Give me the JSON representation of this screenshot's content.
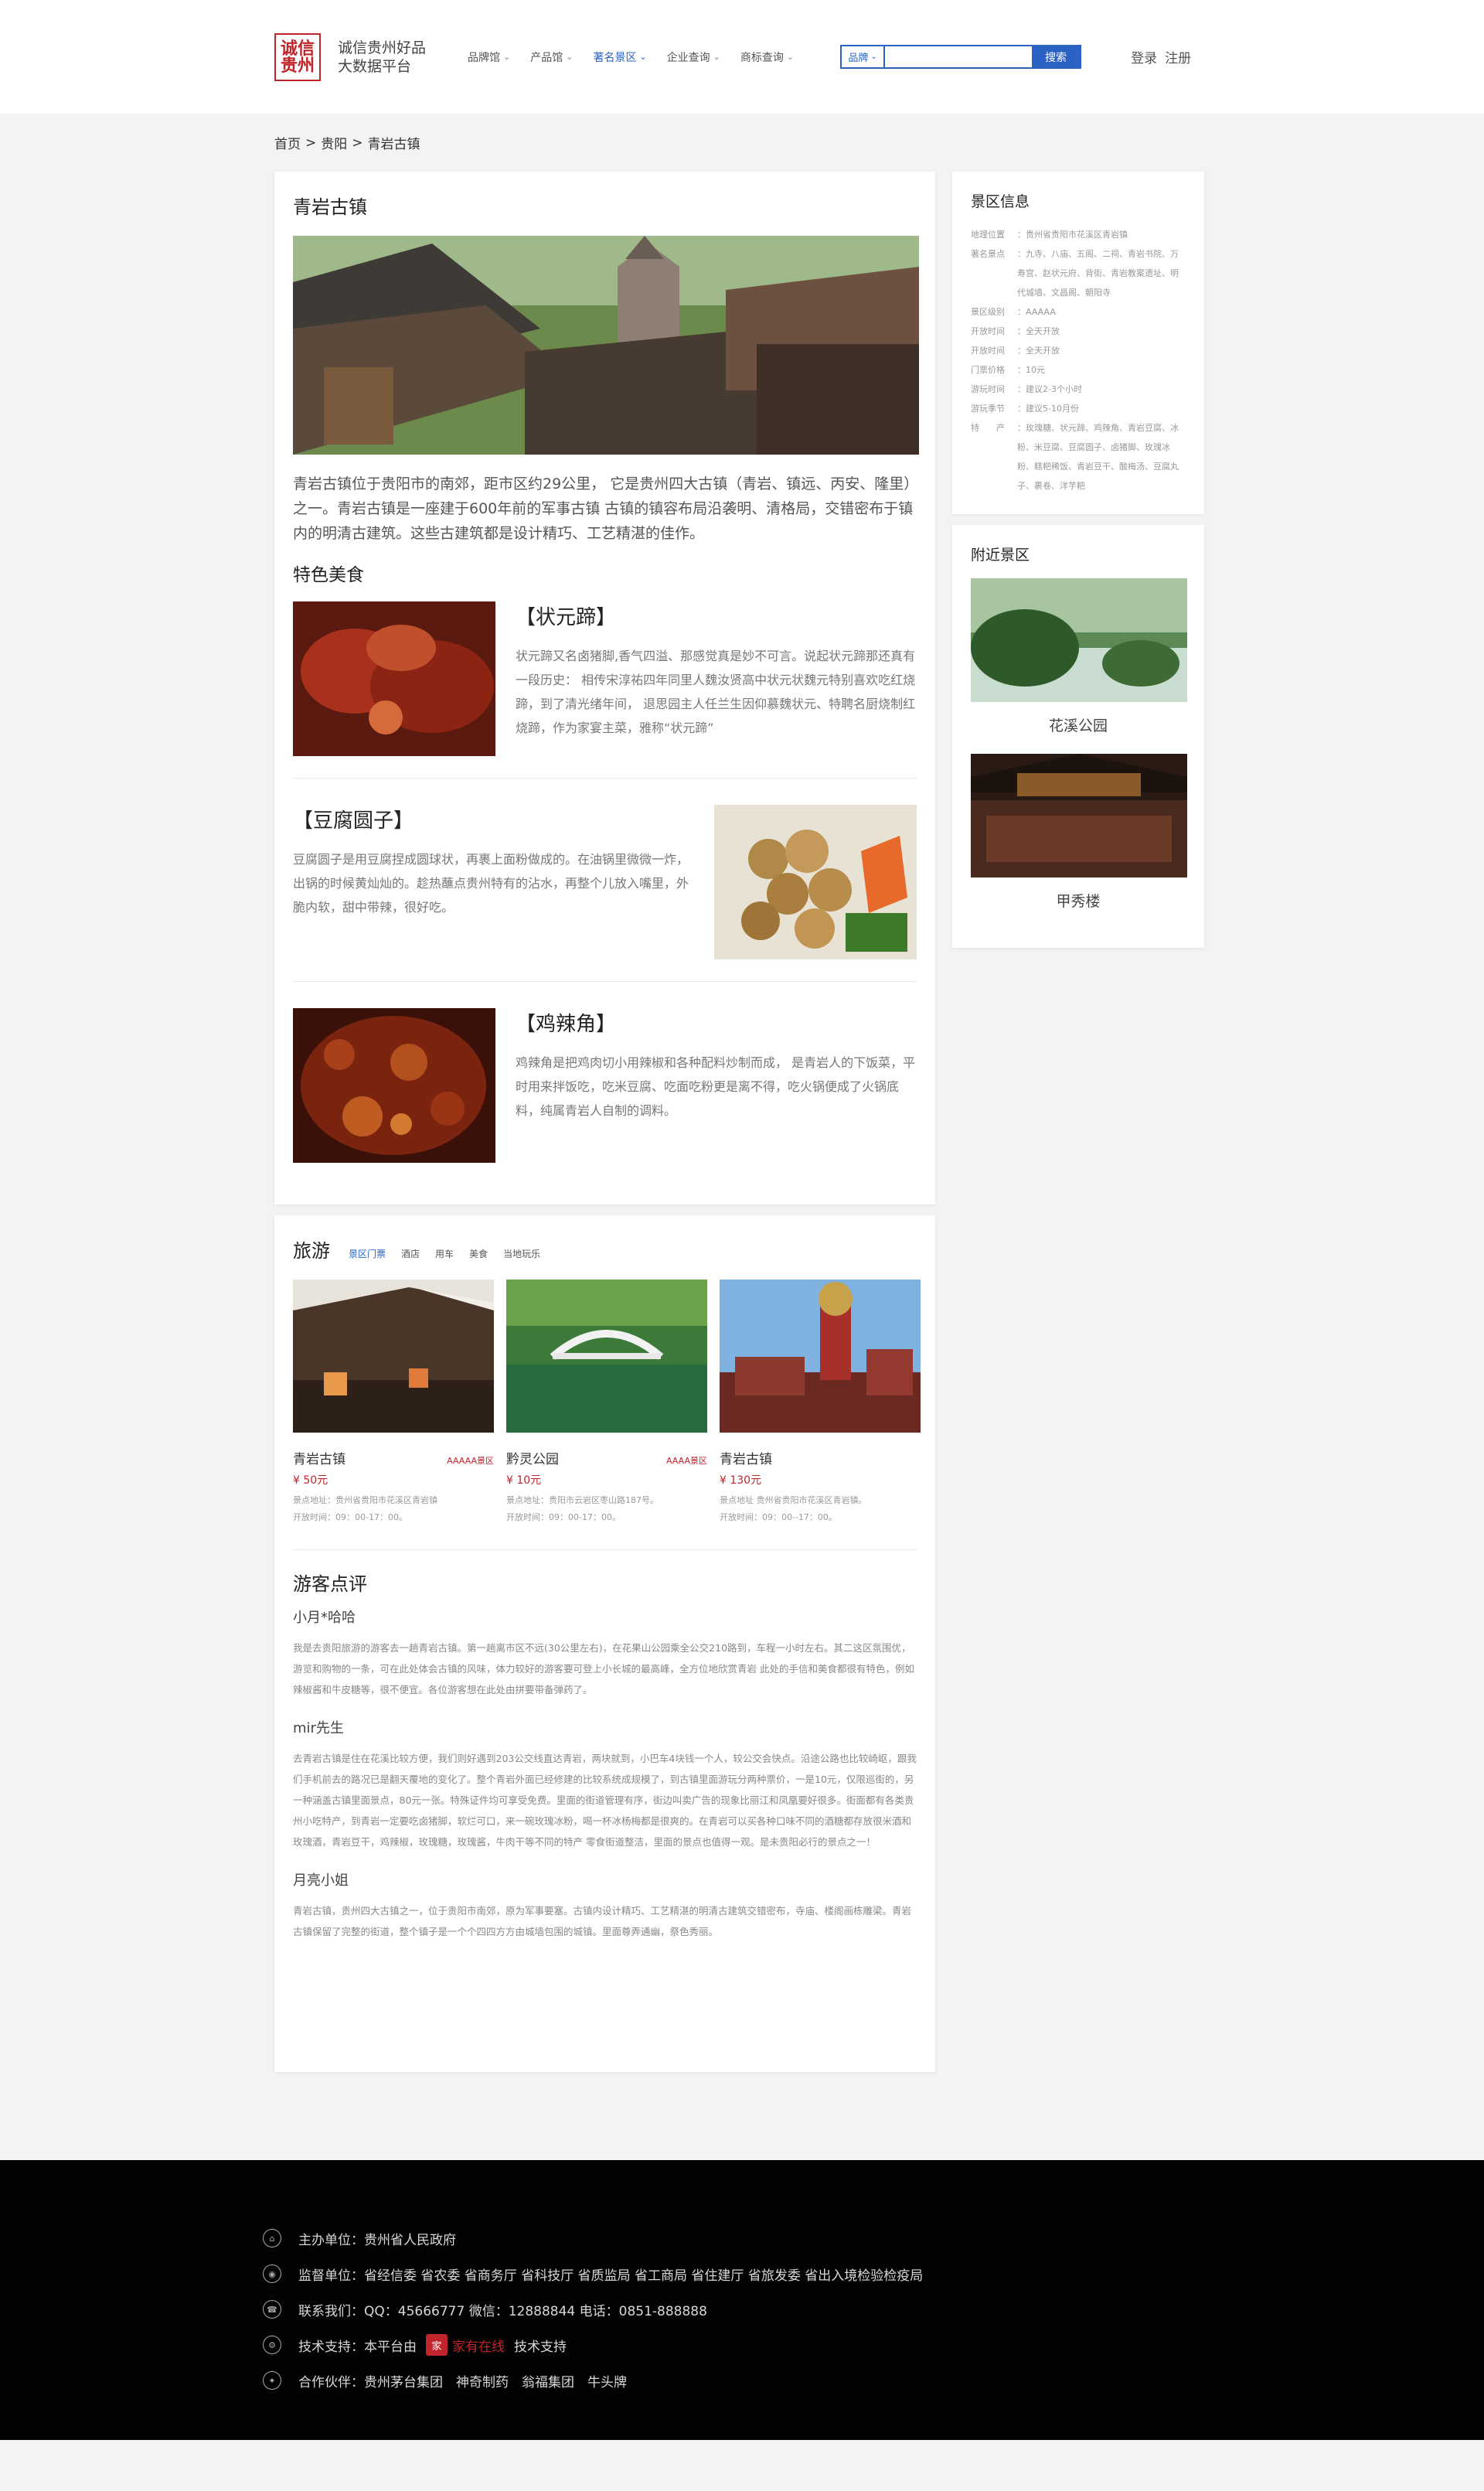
{
  "header": {
    "logo_mark": "诚信 贵州",
    "logo_line1": "诚信贵州好品",
    "logo_line2": "大数据平台",
    "nav": [
      {
        "label": "品牌馆",
        "active": false
      },
      {
        "label": "产品馆",
        "active": false
      },
      {
        "label": "著名景区",
        "active": true
      },
      {
        "label": "企业查询",
        "active": false
      },
      {
        "label": "商标查询",
        "active": false
      }
    ],
    "search": {
      "category": "品牌",
      "placeholder": "",
      "button": "搜索"
    },
    "login": "登录",
    "register": "注册"
  },
  "breadcrumb": [
    "首页",
    ">",
    "贵阳",
    ">",
    "青岩古镇"
  ],
  "main": {
    "title": "青岩古镇",
    "intro": "青岩古镇位于贵阳市的南郊，距市区约29公里， 它是贵州四大古镇（青岩、镇远、丙安、隆里）之一。青岩古镇是一座建于600年前的军事古镇 古镇的镇容布局沿袭明、清格局，交错密布于镇内的明清古建筑。这些古建筑都是设计精巧、工艺精湛的佳作。",
    "food_heading": "特色美食",
    "foods": [
      {
        "title": "【状元蹄】",
        "desc": "状元蹄又名卤猪脚,香气四溢、那感觉真是妙不可言。说起状元蹄那还真有一段历史： 相传宋淳祐四年同里人魏汝贤高中状元状魏元特别喜欢吃红烧蹄，到了清光绪年间， 退思园主人任兰生因仰慕魏状元、特聘名厨烧制红烧蹄，作为家宴主菜，雅称“状元蹄”"
      },
      {
        "title": "【豆腐圆子】",
        "desc": "豆腐圆子是用豆腐捏成圆球状，再裹上面粉做成的。在油锅里微微一炸，出锅的时候黄灿灿的。趁热蘸点贵州特有的沾水，再整个儿放入嘴里，外脆内软，甜中带辣，很好吃。"
      },
      {
        "title": "【鸡辣角】",
        "desc": "鸡辣角是把鸡肉切小用辣椒和各种配料炒制而成， 是青岩人的下饭菜，平时用来拌饭吃，吃米豆腐、吃面吃粉更是离不得，吃火锅便成了火锅底料，纯属青岩人自制的调料。"
      }
    ]
  },
  "tour": {
    "heading": "旅游",
    "tabs": [
      "景区门票",
      "酒店",
      "用车",
      "美食",
      "当地玩乐"
    ],
    "spots": [
      {
        "name": "青岩古镇",
        "level": "AAAAA景区",
        "price": "¥ 50元",
        "addr": "景点地址：贵州省贵阳市花溪区青岩镇",
        "hours": "开放时间：09：00-17：00。"
      },
      {
        "name": "黔灵公园",
        "level": "AAAA景区",
        "price": "¥ 10元",
        "addr": "景点地址：贵阳市云岩区枣山路187号。",
        "hours": "开放时间：09：00-17：00。"
      },
      {
        "name": "青岩古镇",
        "level": "",
        "price": "¥ 130元",
        "addr": "景点地址 贵州省贵阳市花溪区青岩镇。",
        "hours": "开放时间：09：00--17：00。"
      }
    ]
  },
  "reviews": {
    "heading": "游客点评",
    "items": [
      {
        "who": "小月*哈哈",
        "text": "我是去贵阳旅游的游客去一趟青岩古镇。第一趟离市区不远(30公里左右)，在花果山公园乘全公交210路到，车程一小时左右。其二这区氛围优，游览和购物的一条，可在此处体会古镇的风味，体力较好的游客要可登上小长城的最高峰，全方位地欣赏青岩 此处的手信和美食都很有特色，例如辣椒酱和牛皮糖等，很不便宜。各位游客想在此处由拼要带备弹药了。"
      },
      {
        "who": "mir先生",
        "text": "去青岩古镇是住在花溪比较方便，我们则好遇到203公交线直达青岩，两块就到，小巴车4块钱一个人，较公交会快点。沿途公路也比较崎岖，跟我们手机前去的路况已是翻天覆地的变化了。整个青岩外面已经修建的比较系统成规模了，到古镇里面游玩分两种票价，一是10元，仅限巡街的，另一种涵盖古镇里面景点，80元一张。特殊证件均可享受免费。里面的街道管理有序，街边叫卖广告的现象比丽江和凤凰要好很多。街面都有各类贵州小吃特产，到青岩一定要吃卤猪脚，软烂可口，来一碗玫瑰冰粉，喝一杯冰杨梅都是很爽的。在青岩可以买各种口味不同的酒糖都存放很米酒和玫瑰酒，青岩豆干，鸡辣椒，玫瑰糖，玫瑰酱，牛肉干等不同的特产 零食街道整洁，里面的景点也值得一观。是未贵阳必行的景点之一！"
      },
      {
        "who": "月亮小姐",
        "text": "青岩古镇，贵州四大古镇之一，位于贵阳市南郊，原为军事要塞。古镇内设计精巧、工艺精湛的明清古建筑交错密布，寺庙、楼阁画栋雕梁。青岩古镇保留了完整的街道，整个镇子是一个个四四方方由城墙包围的城镇。里面尊弄通幽，祭色秀丽。"
      }
    ]
  },
  "side": {
    "info_heading": "景区信息",
    "info": [
      {
        "k": "地理位置",
        "v": "：贵州省贵阳市花溪区青岩镇"
      },
      {
        "k": "著名景点",
        "v": "：九寺、八庙、五阁、二祠、青岩书院、万寿宫、赵状元府、背街、青岩教案遗址、明代城墙、文昌阁、朝阳寺"
      },
      {
        "k": "景区级别",
        "v": "：AAAAA"
      },
      {
        "k": "开放时间",
        "v": "：全天开放"
      },
      {
        "k": "开放时间",
        "v": "：全天开放"
      },
      {
        "k": "门票价格",
        "v": "：10元"
      },
      {
        "k": "游玩时间",
        "v": "：建议2-3个小时"
      },
      {
        "k": "游玩季节",
        "v": "：建议5-10月份"
      },
      {
        "k": "特　　产",
        "v": "：玫瑰糖、状元蹄、鸡辣角、青岩豆腐、冰粉、米豆腐、豆腐圆子、卤猪脚、玫瑰冰粉、糕粑稀饭、青岩豆干、酸梅汤、豆腐丸子、裹卷、洋芋粑"
      }
    ],
    "nearby_heading": "附近景区",
    "nearby": [
      {
        "name": "花溪公园"
      },
      {
        "name": "甲秀楼"
      }
    ]
  },
  "footer": {
    "rows": [
      {
        "label": "主办单位：",
        "value": "贵州省人民政府"
      },
      {
        "label": "监督单位：",
        "value": "省经信委 省农委 省商务厅 省科技厅 省质监局 省工商局 省住建厅 省旅发委 省出入境检验检疫局"
      },
      {
        "label": "联系我们：",
        "value": "QQ：45666777 微信：12888844 电话：0851-888888"
      },
      {
        "label": "技术支持：",
        "value": "本平台由",
        "brand": "家有在线",
        "brand_mark": "家",
        "suffix": "技术支持"
      },
      {
        "label": "合作伙伴：",
        "value": "贵州茅台集团　神奇制药　翁福集团　牛头牌"
      }
    ]
  },
  "colors": {
    "accent": "#2a63c4",
    "brand_red": "#c0252b"
  }
}
